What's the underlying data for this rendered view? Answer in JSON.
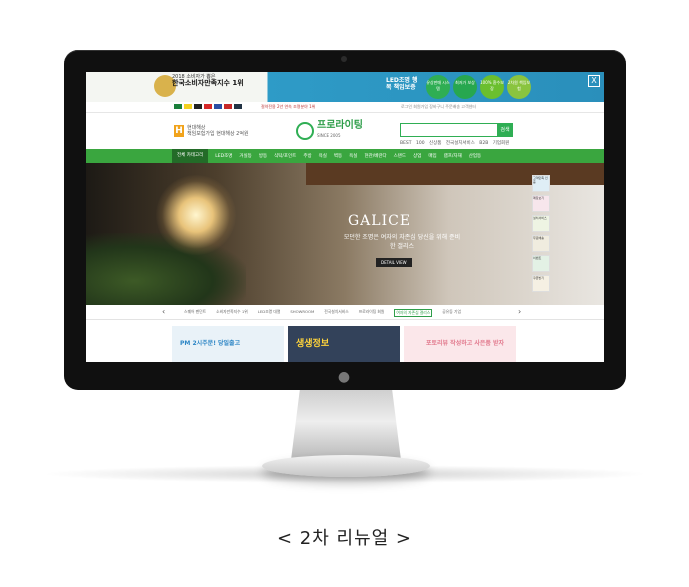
{
  "caption": "< 2차 리뉴얼 >",
  "site": {
    "top_banner": {
      "award_small": "2018 소비자가 뽑은",
      "award_title": "한국소비자만족지수 1위",
      "promo_title": "LED조명 행복 책임보증",
      "circles": [
        "유상판매 시스템",
        "최저가 보상",
        "100% 환수보장",
        "2차원 책임보험"
      ],
      "close_label": "X",
      "circle_colors": [
        "#2fae54",
        "#27a74f",
        "#6bbf2e",
        "#8ac43f"
      ]
    },
    "util_bar": {
      "middle_text": "절약전용 2년 연속 조명분야 1위",
      "right_text": "로그인  회원가입  장바구니  주문배송  고객센터"
    },
    "header": {
      "logo_letter": "H",
      "logo_text_small": "현대해상",
      "logo_text": "책임보험가입 현대해상 2억원",
      "brand_name": "프로라이팅",
      "brand_tag": "SINCE 2005",
      "search_button": "검색",
      "links": [
        "BEST 100",
        "신상품",
        "전국설치서비스",
        "B2B 기업회원"
      ]
    },
    "nav": {
      "category_button": "전체 카테고리",
      "items": [
        "LED조명",
        "거실등",
        "방등",
        "식탁/포인트",
        "주방",
        "욕실",
        "벽등",
        "욕실",
        "현관/베란다",
        "스탠드",
        "상업",
        "매입",
        "램프/자재",
        "산업등"
      ]
    },
    "hero": {
      "title": "GALICE",
      "subtitle": "모던한 조명은 여자의 자존심 당신을 위해 준비한 갤리스",
      "button": "DETAIL VIEW",
      "side_ads": [
        "고객만족 인증",
        "매장보기",
        "설치서비스",
        "무료배송",
        "이벤트",
        "쿠폰받기"
      ]
    },
    "sub_tabs": {
      "prev": "‹",
      "next": "›",
      "items": [
        "스퀘어 펜던트",
        "소비자만족지수 1위",
        "LED조명 대열",
        "SHOWROOM",
        "전국설치서비스",
        "프로라이팅 회원",
        "여자의 자존심 갤리스",
        "공유등 기업"
      ],
      "active_index": 6
    },
    "cards": [
      {
        "title": "PM 2시주문! 당일출고",
        "bg": "#e9f2f8",
        "color": "#2d86c5"
      },
      {
        "title": "생생정보",
        "bg": "#33425a",
        "color": "#ffd43b"
      },
      {
        "title": "포토리뷰 작성하고 사은품 받자",
        "bg": "#fbe7ea",
        "color": "#e27a8e"
      }
    ]
  }
}
